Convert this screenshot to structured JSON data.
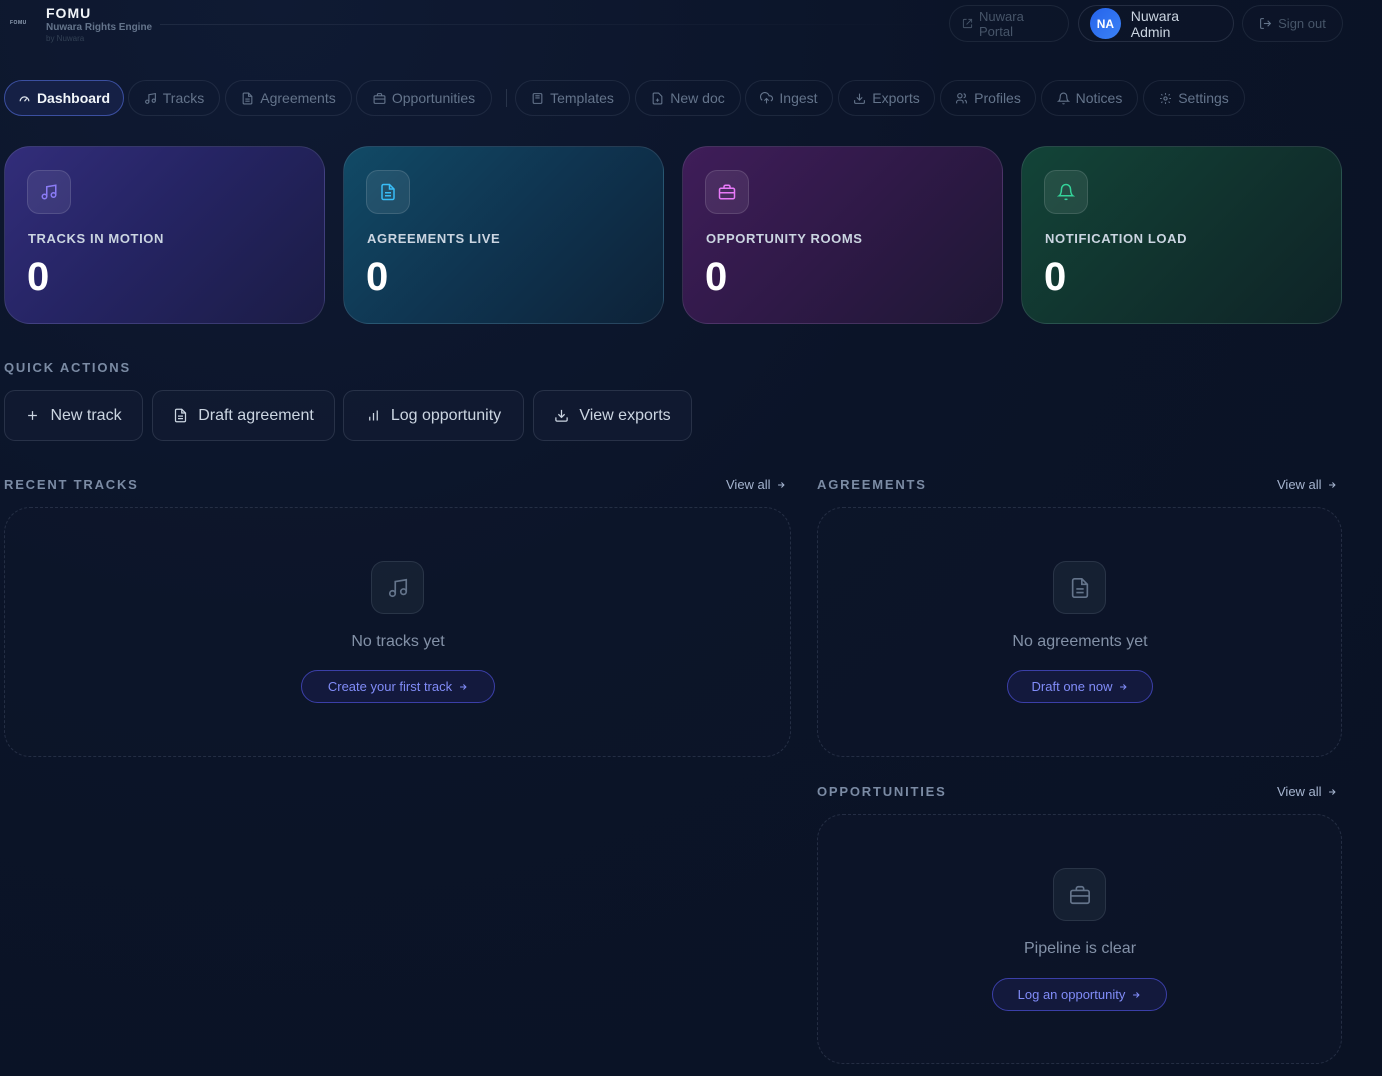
{
  "header": {
    "logo_mark": "FOMU",
    "brand_title": "FOMU",
    "brand_subtitle": "Nuwara Rights Engine",
    "brand_by": "by Nuwara",
    "portal_label": "Nuwara Portal",
    "user_initials": "NA",
    "user_name": "Nuwara Admin",
    "signout_label": "Sign out"
  },
  "nav": {
    "tabs": [
      {
        "label": "Dashboard",
        "icon": "gauge-icon"
      },
      {
        "label": "Tracks",
        "icon": "music-icon"
      },
      {
        "label": "Agreements",
        "icon": "file-text-icon"
      },
      {
        "label": "Opportunities",
        "icon": "briefcase-icon"
      },
      {
        "label": "Templates",
        "icon": "template-icon"
      },
      {
        "label": "New doc",
        "icon": "file-plus-icon"
      },
      {
        "label": "Ingest",
        "icon": "cloud-upload-icon"
      },
      {
        "label": "Exports",
        "icon": "download-icon"
      },
      {
        "label": "Profiles",
        "icon": "users-icon"
      },
      {
        "label": "Notices",
        "icon": "bell-icon"
      },
      {
        "label": "Settings",
        "icon": "gear-icon"
      }
    ],
    "active": "Dashboard"
  },
  "stats": [
    {
      "label": "TRACKS IN MOTION",
      "value": "0",
      "icon": "music-icon",
      "accent": "#8b7cf6"
    },
    {
      "label": "AGREEMENTS LIVE",
      "value": "0",
      "icon": "file-text-icon",
      "accent": "#38bdf8"
    },
    {
      "label": "OPPORTUNITY ROOMS",
      "value": "0",
      "icon": "briefcase-icon",
      "accent": "#e879f9"
    },
    {
      "label": "NOTIFICATION LOAD",
      "value": "0",
      "icon": "bell-icon",
      "accent": "#34d399"
    }
  ],
  "quick_actions": {
    "title": "QUICK ACTIONS",
    "items": [
      {
        "label": "New track",
        "icon": "plus-icon"
      },
      {
        "label": "Draft agreement",
        "icon": "file-text-icon"
      },
      {
        "label": "Log opportunity",
        "icon": "bar-chart-icon"
      },
      {
        "label": "View exports",
        "icon": "download-icon"
      }
    ]
  },
  "recent_tracks": {
    "title": "RECENT TRACKS",
    "view_all": "View all",
    "empty_text": "No tracks yet",
    "cta": "Create your first track"
  },
  "agreements": {
    "title": "AGREEMENTS",
    "view_all": "View all",
    "empty_text": "No agreements yet",
    "cta": "Draft one now"
  },
  "opportunities": {
    "title": "OPPORTUNITIES",
    "view_all": "View all",
    "empty_text": "Pipeline is clear",
    "cta": "Log an opportunity"
  },
  "colors": {
    "background": "#0b1428",
    "accent": "#818cf8",
    "avatar": "#2563eb"
  }
}
